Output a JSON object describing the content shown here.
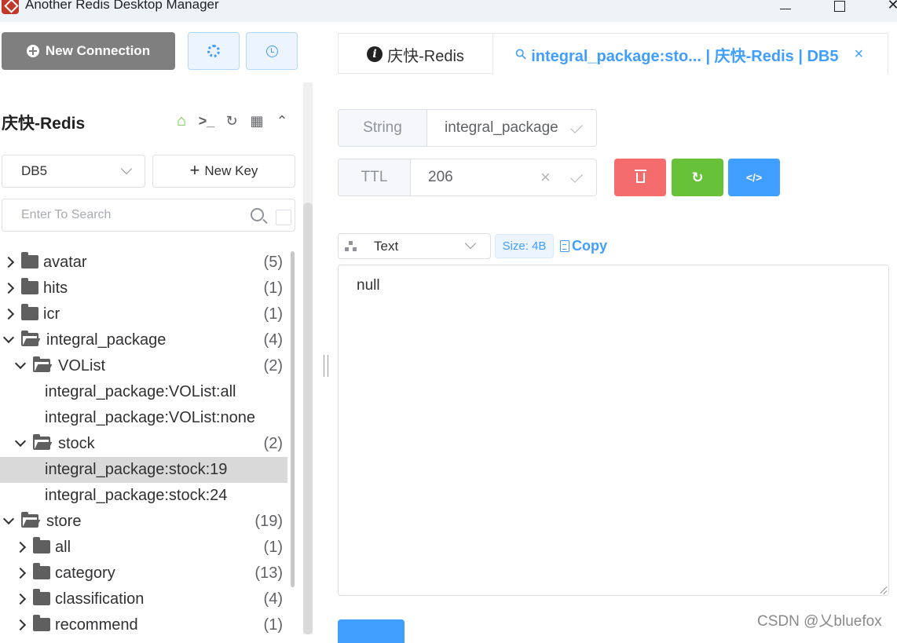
{
  "window": {
    "title": "Another Redis Desktop Manager"
  },
  "sidebar": {
    "new_connection_label": "New Connection",
    "connection_name": "庆快-Redis",
    "db_select": "DB5",
    "new_key_label": "New Key",
    "search_placeholder": "Enter To Search",
    "tree": [
      {
        "label": "avatar",
        "count": "(5)",
        "level": 0,
        "type": "folder",
        "expanded": false
      },
      {
        "label": "hits",
        "count": "(1)",
        "level": 0,
        "type": "folder",
        "expanded": false
      },
      {
        "label": "icr",
        "count": "(1)",
        "level": 0,
        "type": "folder",
        "expanded": false
      },
      {
        "label": "integral_package",
        "count": "(4)",
        "level": 0,
        "type": "folder",
        "expanded": true
      },
      {
        "label": "VOList",
        "count": "(2)",
        "level": 1,
        "type": "folder",
        "expanded": true
      },
      {
        "label": "integral_package:VOList:all",
        "count": "",
        "level": 2,
        "type": "key"
      },
      {
        "label": "integral_package:VOList:none",
        "count": "",
        "level": 2,
        "type": "key"
      },
      {
        "label": "stock",
        "count": "(2)",
        "level": 1,
        "type": "folder",
        "expanded": true
      },
      {
        "label": "integral_package:stock:19",
        "count": "",
        "level": 2,
        "type": "key",
        "selected": true
      },
      {
        "label": "integral_package:stock:24",
        "count": "",
        "level": 2,
        "type": "key"
      },
      {
        "label": "store",
        "count": "(19)",
        "level": 0,
        "type": "folder",
        "expanded": true
      },
      {
        "label": "all",
        "count": "(1)",
        "level": 1,
        "type": "folder",
        "expanded": false
      },
      {
        "label": "category",
        "count": "(13)",
        "level": 1,
        "type": "folder",
        "expanded": false
      },
      {
        "label": "classification",
        "count": "(4)",
        "level": 1,
        "type": "folder",
        "expanded": false
      },
      {
        "label": "recommend",
        "count": "(1)",
        "level": 1,
        "type": "folder",
        "expanded": false
      }
    ]
  },
  "tabs": {
    "info_tab": "庆快-Redis",
    "key_tab": "integral_package:sto... | 庆快-Redis | DB5",
    "close_glyph": "×"
  },
  "key_detail": {
    "type_label": "String",
    "key_name": "integral_package",
    "ttl_label": "TTL",
    "ttl_value": "206",
    "view_mode": "Text",
    "size": "Size: 4B",
    "copy_label": "Copy",
    "value": "null"
  },
  "watermark": "CSDN @乂bluefox",
  "colors": {
    "primary": "#409eff",
    "danger": "#f56c6c",
    "success": "#67c23a",
    "selected_row": "#d9d9d9"
  }
}
